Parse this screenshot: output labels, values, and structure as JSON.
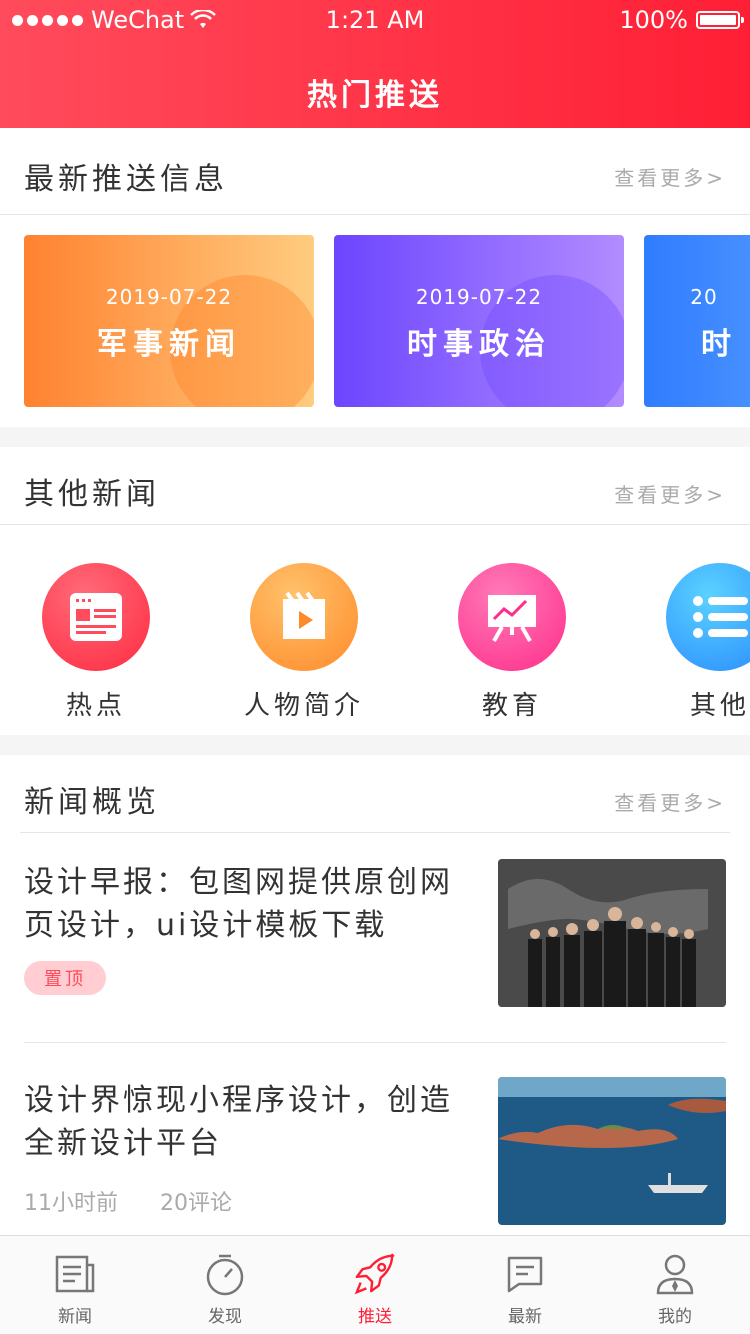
{
  "status_bar": {
    "carrier": "WeChat",
    "time": "1:21 AM",
    "battery": "100%"
  },
  "header": {
    "title": "热门推送"
  },
  "latest": {
    "title": "最新推送信息",
    "more": "查看更多>",
    "cards": [
      {
        "date": "2019-07-22",
        "name": "军事新闻"
      },
      {
        "date": "2019-07-22",
        "name": "时事政治"
      },
      {
        "date": "20",
        "name": "时"
      }
    ]
  },
  "other": {
    "title": "其他新闻",
    "more": "查看更多>",
    "categories": [
      {
        "label": "热点",
        "icon": "news-list-icon"
      },
      {
        "label": "人物简介",
        "icon": "video-play-icon"
      },
      {
        "label": "教育",
        "icon": "presentation-chart-icon"
      },
      {
        "label": "其他",
        "icon": "menu-list-icon"
      }
    ]
  },
  "overview": {
    "title": "新闻概览",
    "more": "查看更多>",
    "items": [
      {
        "title": "设计早报：包图网提供原创网页设计，ui设计模板下载",
        "badge": "置顶",
        "image": "business-team-photo"
      },
      {
        "title": "设计界惊现小程序设计，创造全新设计平台",
        "time": "11小时前",
        "comments": "20评论",
        "image": "coastal-island-photo"
      }
    ]
  },
  "tabbar": {
    "tabs": [
      {
        "label": "新闻",
        "icon": "newspaper-icon"
      },
      {
        "label": "发现",
        "icon": "stopwatch-icon"
      },
      {
        "label": "推送",
        "icon": "rocket-icon"
      },
      {
        "label": "最新",
        "icon": "message-icon"
      },
      {
        "label": "我的",
        "icon": "user-icon"
      }
    ],
    "active": "推送"
  },
  "colors": {
    "accent": "#ff1f35",
    "card1": "#ff8a3d",
    "card2": "#7b4dff",
    "card3": "#3d8bff"
  }
}
